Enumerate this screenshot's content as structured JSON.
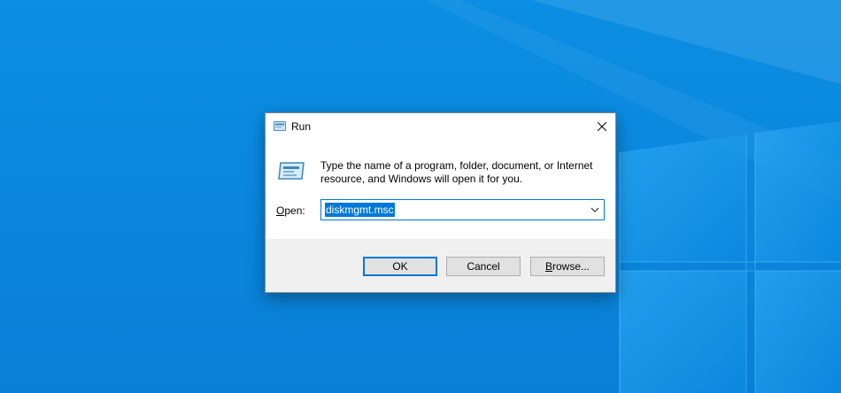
{
  "desktop": {
    "background_color": "#0a86dc"
  },
  "dialog": {
    "title": "Run",
    "title_icon": "run-icon",
    "close_icon": "close-icon",
    "description": "Type the name of a program, folder, document, or Internet resource, and Windows will open it for you.",
    "open_label_accel": "O",
    "open_label_rest": "pen:",
    "open_value": "diskmgmt.msc",
    "accent_color": "#0078d7",
    "buttons": {
      "ok": "OK",
      "cancel": "Cancel",
      "browse_accel": "B",
      "browse_rest": "rowse..."
    }
  }
}
